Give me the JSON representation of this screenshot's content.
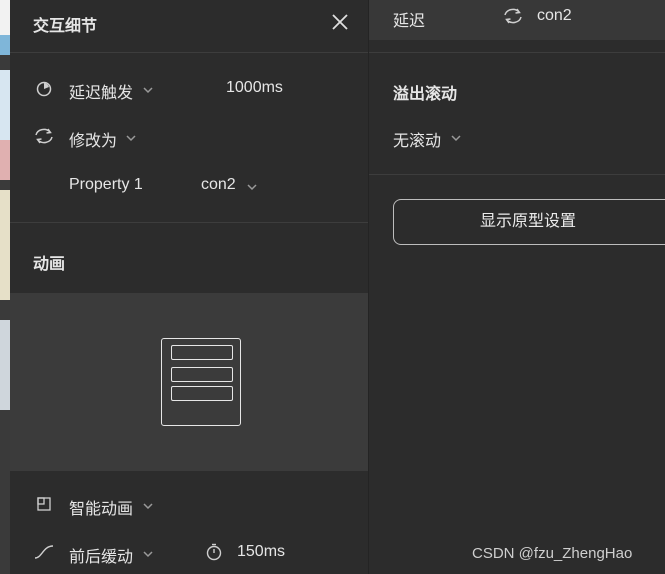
{
  "panel": {
    "title": "交互细节",
    "trigger": {
      "label": "延迟触发",
      "value": "1000ms"
    },
    "action": {
      "label": "修改为"
    },
    "property": {
      "name": "Property 1",
      "value": "con2"
    },
    "animation_section": {
      "title": "动画"
    },
    "animation": {
      "label": "智能动画"
    },
    "easing": {
      "label": "前后缓动",
      "duration": "150ms"
    }
  },
  "right": {
    "top": {
      "delay_label": "延迟",
      "target": "con2"
    },
    "overflow": {
      "title": "溢出滚动",
      "value": "无滚动"
    },
    "prototype_button": "显示原型设置"
  },
  "watermark": "CSDN @fzu_ZhengHao",
  "icons": [
    "timer-trigger-icon",
    "swap-icon",
    "smart-animate-icon",
    "ease-curve-icon",
    "stopwatch-icon",
    "close-icon",
    "chevron-down-icon"
  ]
}
